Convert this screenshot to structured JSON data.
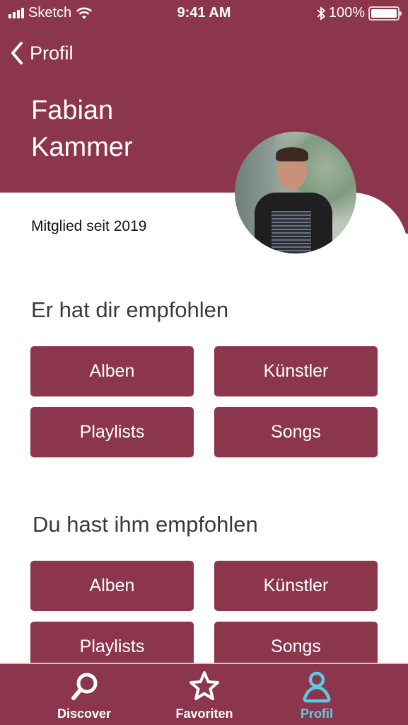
{
  "status_bar": {
    "carrier": "Sketch",
    "time": "9:41 AM",
    "battery": "100%"
  },
  "nav": {
    "back_label": "Profil"
  },
  "profile": {
    "first_name": "Fabian",
    "last_name": "Kammer",
    "member_since": "Mitglied seit 2019",
    "avatar_icon": "profile-photo"
  },
  "sections": [
    {
      "title": "Er hat dir empfohlen",
      "buttons": [
        "Alben",
        "Künstler",
        "Playlists",
        "Songs"
      ]
    },
    {
      "title": "Du hast ihm empfohlen",
      "buttons": [
        "Alben",
        "Künstler",
        "Playlists",
        "Songs"
      ]
    }
  ],
  "tabbar": {
    "items": [
      {
        "label": "Discover",
        "icon": "search-icon",
        "active": false
      },
      {
        "label": "Favoriten",
        "icon": "star-icon",
        "active": false
      },
      {
        "label": "Profil",
        "icon": "person-icon",
        "active": true
      }
    ]
  },
  "colors": {
    "brand": "#8c364d",
    "active_tab": "#5acbe3",
    "heading": "#3a3a3a"
  }
}
